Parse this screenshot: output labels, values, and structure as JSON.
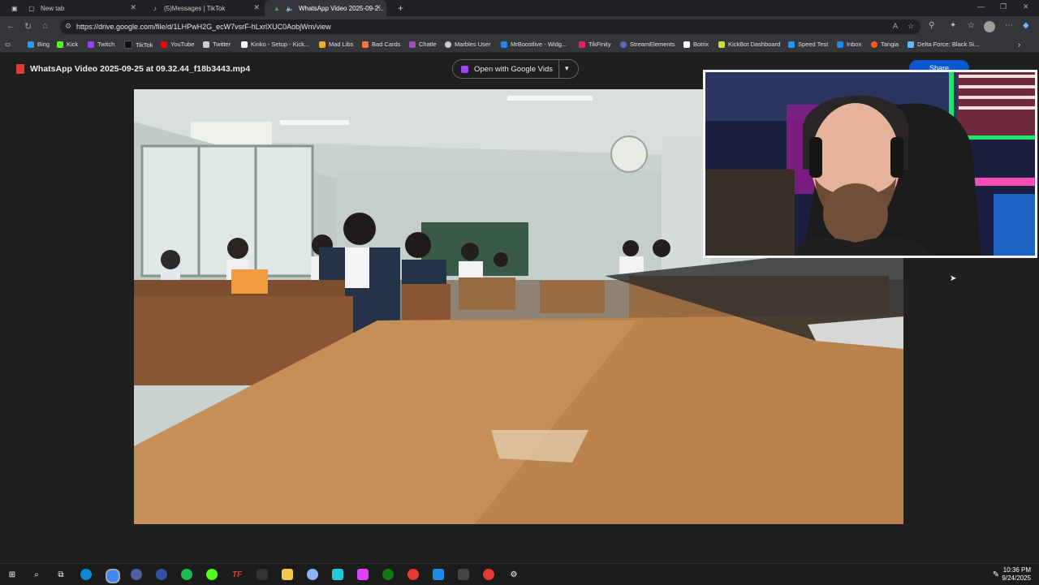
{
  "tabs": [
    {
      "title": "New tab",
      "icon": "page-icon"
    },
    {
      "title": "(5)Messages | TikTok",
      "icon": "tiktok-icon"
    },
    {
      "title": "WhatsApp Video 2025-09-2...",
      "icon": "drive-icon"
    }
  ],
  "address": {
    "url": "https://drive.google.com/file/d/1LHPwH2G_ecW7vsrF-hLxrlXUC0AobjWm/view"
  },
  "bookmarks": [
    {
      "label": "Bing",
      "color": "#2b9af3"
    },
    {
      "label": "Kick",
      "color": "#53fc18"
    },
    {
      "label": "Twitch",
      "color": "#9146ff"
    },
    {
      "label": "TikTok",
      "color": "#111111"
    },
    {
      "label": "YouTube",
      "color": "#ff0000"
    },
    {
      "label": "Twitter",
      "color": "#cccccc"
    },
    {
      "label": "Kinko - Setup - Kick...",
      "color": "#ffffff"
    },
    {
      "label": "Mad Libs",
      "color": "#f9a825"
    },
    {
      "label": "Bad Cards",
      "color": "#ff7043"
    },
    {
      "label": "Chatle",
      "color": "#ab47bc"
    },
    {
      "label": "Marbles User",
      "color": "#cccccc"
    },
    {
      "label": "MrBoostlive - Widg...",
      "color": "#1e88e5"
    },
    {
      "label": "TikFinity",
      "color": "#e91e63"
    },
    {
      "label": "StreamElements",
      "color": "#5c6bc0"
    },
    {
      "label": "Botrix",
      "color": "#ffffff"
    },
    {
      "label": "KickBot Dashboard",
      "color": "#cddc39"
    },
    {
      "label": "Speed Test",
      "color": "#2196f3"
    },
    {
      "label": "Inbox",
      "color": "#1e88e5"
    },
    {
      "label": "Tangia",
      "color": "#ff5722"
    },
    {
      "label": "Delta Force: Black Si...",
      "color": "#64b5f6"
    }
  ],
  "viewer": {
    "file_title": "WhatsApp Video 2025-09-25 at 09.32.44_f18b3443.mp4",
    "open_with_label": "Open with Google Vids",
    "share_label": "Share"
  },
  "clock": {
    "time": "10:36 PM",
    "date": "9/24/2025"
  },
  "taskbar_apps": [
    {
      "icon": "edge-icon",
      "color": "#0c8ad6"
    },
    {
      "icon": "chrome-icon",
      "color": "#4285f4"
    },
    {
      "icon": "app-icon",
      "color": "#5060a0"
    },
    {
      "icon": "app-icon",
      "color": "#3050a0"
    },
    {
      "icon": "spotify-icon",
      "color": "#1db954"
    },
    {
      "icon": "kick-icon",
      "color": "#53fc18"
    },
    {
      "icon": "tf-icon",
      "color": "#e53935"
    },
    {
      "icon": "obs-icon",
      "color": "#333333"
    },
    {
      "icon": "folder-icon",
      "color": "#f9c74f"
    },
    {
      "icon": "app-icon",
      "color": "#8ab4f8"
    },
    {
      "icon": "app-icon",
      "color": "#26c6da"
    },
    {
      "icon": "app-icon",
      "color": "#e040fb"
    },
    {
      "icon": "xbox-icon",
      "color": "#107c10"
    },
    {
      "icon": "app-icon",
      "color": "#e53935"
    },
    {
      "icon": "app-icon",
      "color": "#1e88e5"
    },
    {
      "icon": "app-icon",
      "color": "#444444"
    },
    {
      "icon": "app-icon",
      "color": "#e53935"
    },
    {
      "icon": "settings-icon",
      "color": "#666666"
    }
  ]
}
